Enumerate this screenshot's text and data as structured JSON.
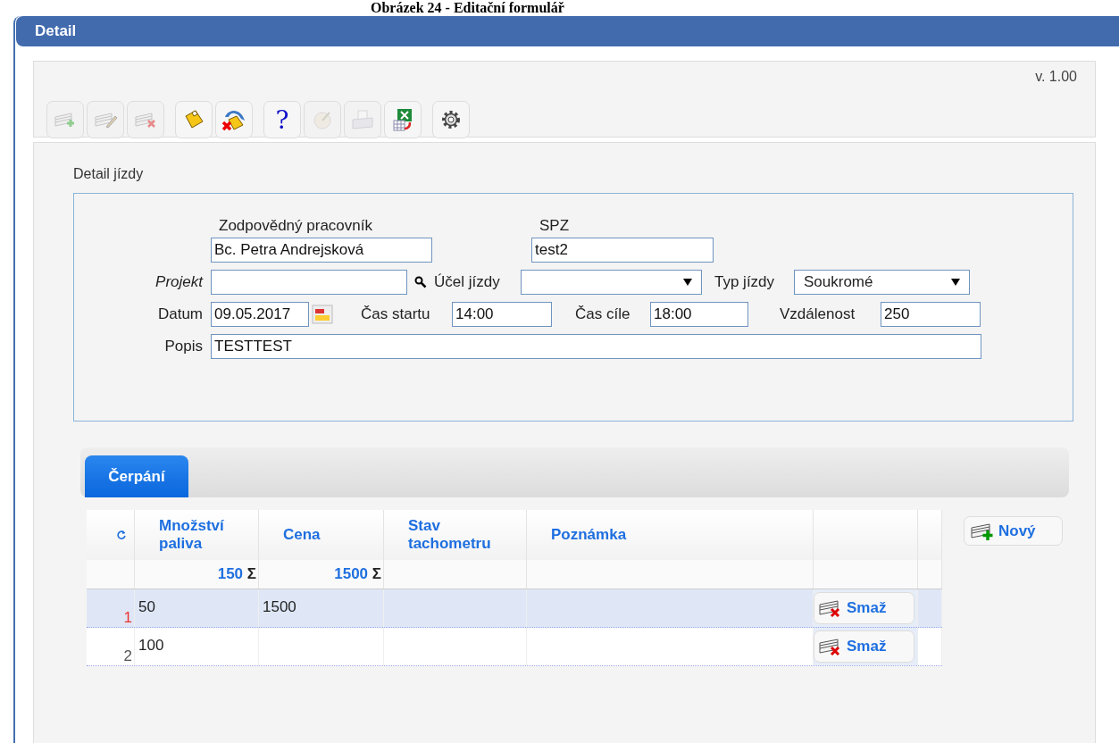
{
  "caption": "Obrázek 24 - Editační formulář",
  "window": {
    "title": "Detail"
  },
  "version": "v. 1.00",
  "toolbar": [
    {
      "buttons": [
        {
          "kind": "add",
          "disabled": true
        },
        {
          "kind": "edit",
          "disabled": true
        },
        {
          "kind": "delete",
          "disabled": true
        }
      ]
    },
    {
      "buttons": [
        {
          "kind": "save",
          "disabled": false
        },
        {
          "kind": "cancel",
          "disabled": false
        }
      ]
    },
    {
      "buttons": [
        {
          "kind": "help",
          "text": "?",
          "disabled": false
        },
        {
          "kind": "chart",
          "disabled": true
        },
        {
          "kind": "print",
          "disabled": true
        },
        {
          "kind": "excel",
          "disabled": false
        }
      ]
    },
    {
      "buttons": [
        {
          "kind": "settings",
          "disabled": false
        }
      ]
    }
  ],
  "section_title": "Detail jízdy",
  "form": {
    "worker": {
      "label": "Zodpovědný pracovník",
      "value": "Bc. Petra Andrejsková"
    },
    "spz": {
      "label": "SPZ",
      "value": "test2"
    },
    "project": {
      "label": "Projekt"
    },
    "purpose": {
      "label": "Účel jízdy"
    },
    "trip_type": {
      "label": "Typ jízdy",
      "value": "Soukromé"
    },
    "date": {
      "label": "Datum",
      "value": "09.05.2017"
    },
    "start_time": {
      "label": "Čas startu",
      "value": "14:00"
    },
    "end_time": {
      "label": "Čas cíle",
      "value": "18:00"
    },
    "distance": {
      "label": "Vzdálenost",
      "value": "250"
    },
    "description": {
      "label": "Popis",
      "value": "TESTTEST"
    }
  },
  "tabs": [
    {
      "label": "Čerpání",
      "selected": true
    }
  ],
  "table": {
    "columns": [
      "Množství paliva",
      "Cena",
      "Stav tachometru",
      "Poznámka"
    ],
    "sums": [
      {
        "value": "150",
        "symbol": "Σ"
      },
      {
        "value": "1500",
        "symbol": "Σ"
      }
    ],
    "rows": [
      {
        "number": "1",
        "cells": [
          "50",
          "1500",
          "",
          ""
        ],
        "selected": true,
        "action": "Smaž"
      },
      {
        "number": "2",
        "cells": [
          "100",
          "",
          "",
          ""
        ],
        "selected": false,
        "action": "Smaž"
      }
    ]
  },
  "new_button": "Nový"
}
